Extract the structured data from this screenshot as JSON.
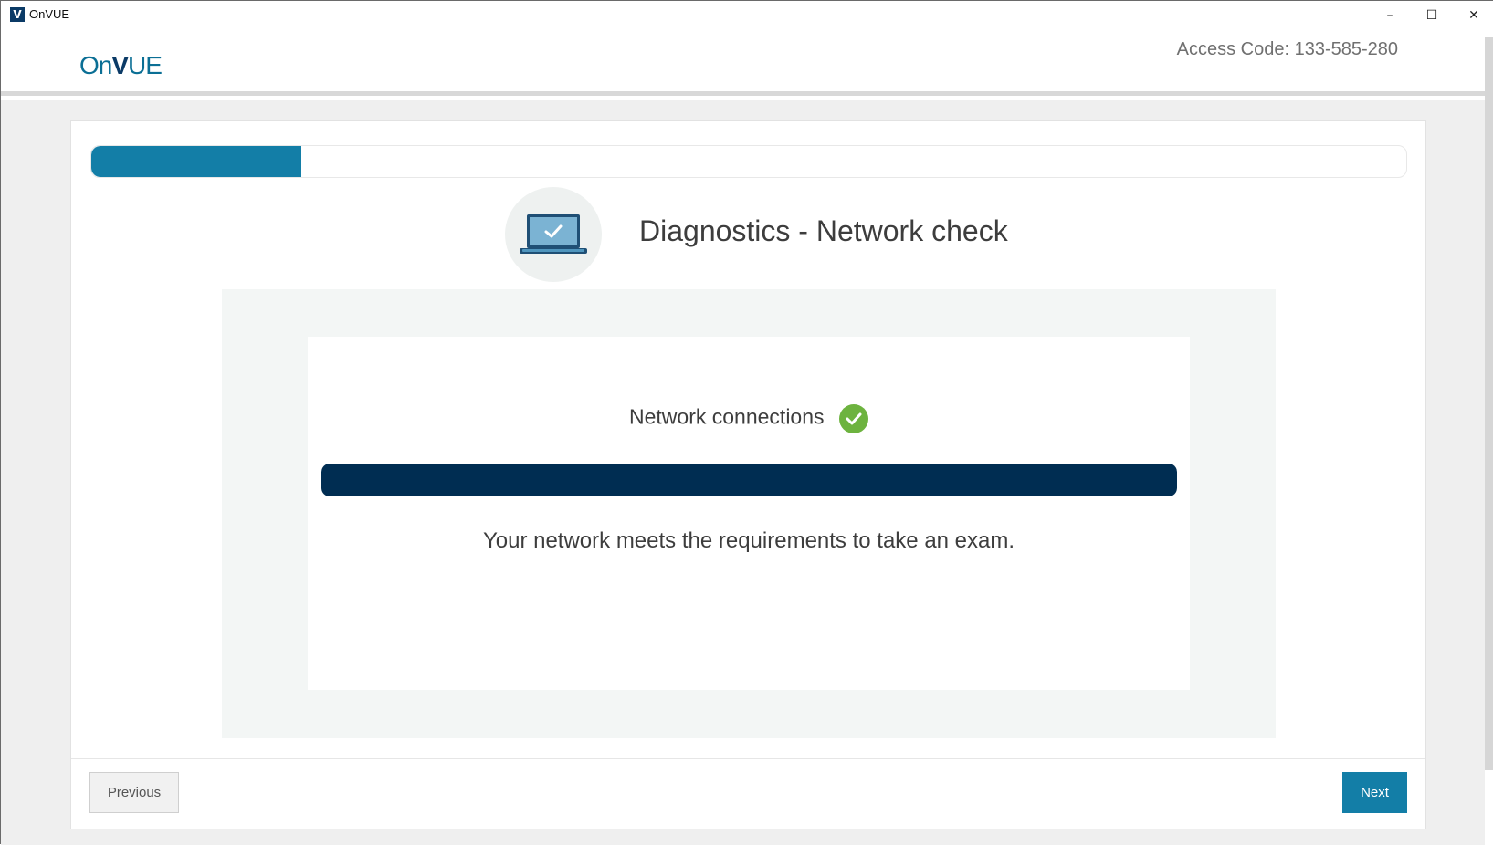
{
  "window": {
    "title": "OnVUE",
    "app_icon_letter": "V",
    "controls": {
      "minimize": "–",
      "maximize": "☐",
      "close": "✕"
    }
  },
  "header": {
    "logo_prefix": "On",
    "logo_v": "V",
    "logo_suffix": "UE",
    "access_code": "Access Code: 133-585-280"
  },
  "progress": {
    "value_percent": 16,
    "color": "#137ea7"
  },
  "page": {
    "title": "Diagnostics - Network check",
    "icon": "laptop-check-icon"
  },
  "network_check": {
    "label": "Network connections",
    "status_icon": "check-circle-icon",
    "status_color": "#6db33f",
    "bar_percent": 100,
    "bar_color": "#002d52",
    "message": "Your network meets the requirements to take an exam."
  },
  "footer": {
    "previous_label": "Previous",
    "next_label": "Next"
  }
}
